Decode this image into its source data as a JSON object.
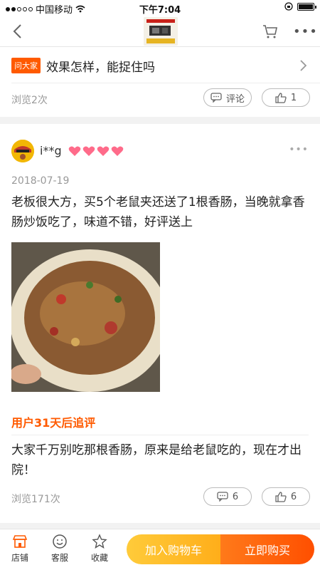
{
  "status_bar": {
    "carrier": "中国移动",
    "time": "下午7:04"
  },
  "question": {
    "badge": "问大家",
    "text": "效果怎样，能捉住吗",
    "views": "浏览2次",
    "comment_label": "评论",
    "like_count": "1"
  },
  "review": {
    "username": "i**g",
    "date": "2018-07-19",
    "text": "老板很大方，买5个老鼠夹还送了1根香肠，当晚就拿香肠炒饭吃了，味道不错，好评送上",
    "followup_header": "用户31天后追评",
    "followup_text": "大家千万别吃那根香肠，原来是给老鼠吃的，现在才出院！",
    "views": "浏览171次",
    "comment_count": "6",
    "like_count": "6"
  },
  "bottom_bar": {
    "store_label": "店铺",
    "service_label": "客服",
    "favorite_label": "收藏",
    "add_to_cart_label": "加入购物车",
    "buy_now_label": "立即购买"
  },
  "colors": {
    "accent": "#ff5a00",
    "cart_button": "#ffb320",
    "buy_button": "#ff6a00"
  }
}
